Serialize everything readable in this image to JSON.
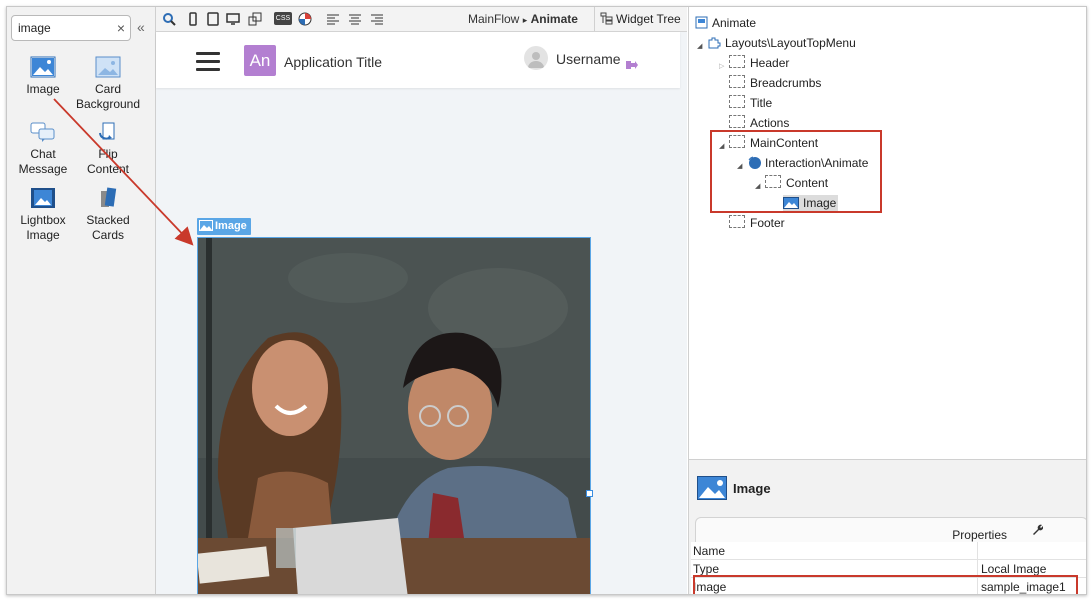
{
  "toolbox": {
    "search_value": "image",
    "clear_glyph": "×",
    "collapse_glyph": "«",
    "items": [
      {
        "label": "Image",
        "icon": "image-icon"
      },
      {
        "label": "Card Background",
        "icon": "card-background-icon"
      },
      {
        "label": "Chat Message",
        "icon": "chat-message-icon"
      },
      {
        "label": "Flip Content",
        "icon": "flip-content-icon"
      },
      {
        "label": "Lightbox Image",
        "icon": "lightbox-image-icon"
      },
      {
        "label": "Stacked Cards",
        "icon": "stacked-cards-icon"
      }
    ]
  },
  "editor": {
    "breadcrumb_flow": "MainFlow",
    "breadcrumb_sep": "▸",
    "breadcrumb_screen": "Animate",
    "widget_tree_tab": "Widget Tree",
    "css_label": "CSS"
  },
  "app_preview": {
    "logo_text": "An",
    "title": "Application Title",
    "username": "Username",
    "image_tag": "Image",
    "accent": "#b37fd1"
  },
  "tree": {
    "root": "Animate",
    "layout": "Layouts\\LayoutTopMenu",
    "nodes": [
      "Header",
      "Breadcrumbs",
      "Title",
      "Actions",
      "MainContent"
    ],
    "interaction": "Interaction\\Animate",
    "content": "Content",
    "image": "Image",
    "footer": "Footer"
  },
  "properties": {
    "title": "Image",
    "tab": "Properties",
    "rows": [
      {
        "key": "Name",
        "value": ""
      },
      {
        "key": "Type",
        "value": "Local Image"
      },
      {
        "key": "Image",
        "value": "sample_image1"
      }
    ]
  },
  "colors": {
    "highlight": "#c9392b",
    "selection": "#5aa6e6"
  }
}
